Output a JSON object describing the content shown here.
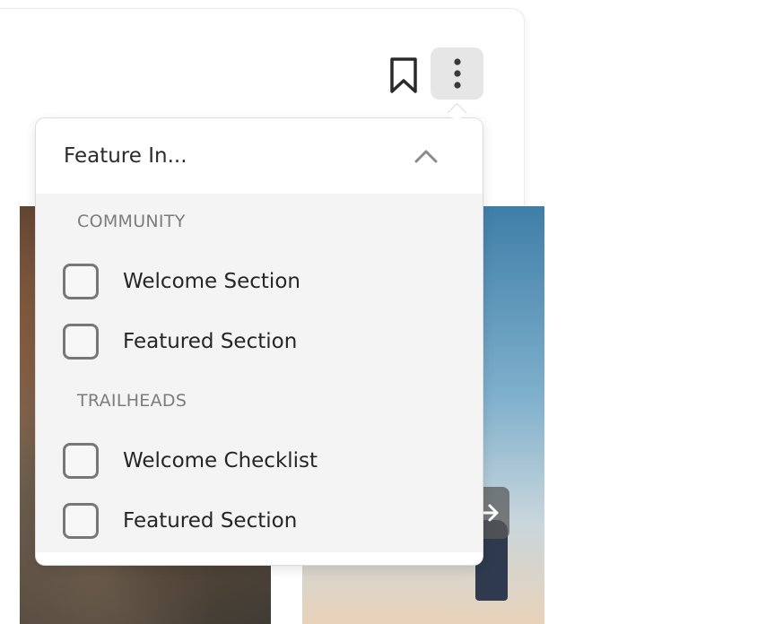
{
  "toolbar": {
    "bookmark_icon": "bookmark-icon",
    "more_icon": "vertical-dots-icon"
  },
  "dropdown": {
    "title": "Feature In...",
    "toggle_icon": "chevron-up-icon",
    "sections": [
      {
        "label": "COMMUNITY",
        "options": [
          {
            "label": "Welcome Section",
            "checked": false
          },
          {
            "label": "Featured Section",
            "checked": false
          }
        ]
      },
      {
        "label": "TRAILHEADS",
        "options": [
          {
            "label": "Welcome Checklist",
            "checked": false
          },
          {
            "label": "Featured Section",
            "checked": false
          }
        ]
      }
    ]
  },
  "carousel": {
    "next_icon": "arrow-right-icon"
  }
}
